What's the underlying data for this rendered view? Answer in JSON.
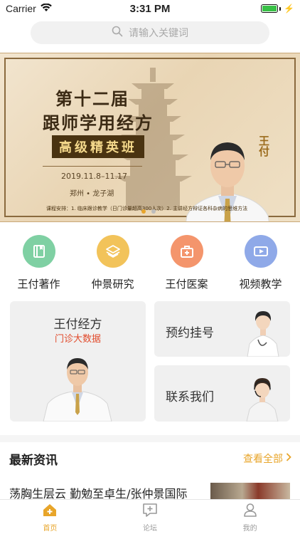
{
  "status_bar": {
    "carrier": "Carrier",
    "time": "3:31 PM",
    "battery_level": 1.0
  },
  "search": {
    "placeholder": "请输入关键词",
    "icon": "search-icon"
  },
  "banner": {
    "title_line1": "第十二届",
    "title_line2": "跟师学用经方",
    "class_badge": "高级精英班",
    "date": "2019.11.8–11.17",
    "location": "郑州 • 龙子湖",
    "teacher_name": "王付",
    "course_info": "课程安排：1. 临床跟诊教学（日门诊量超高300人次）2. 主讲经方辩证各科杂病的思维方法",
    "page_count": 2,
    "active_page": 1
  },
  "categories": [
    {
      "label": "王付著作",
      "icon": "book-icon",
      "color": "#7fd0a3"
    },
    {
      "label": "仲景研究",
      "icon": "layers-icon",
      "color": "#f2c35a"
    },
    {
      "label": "王付医案",
      "icon": "medical-kit-icon",
      "color": "#f4956c"
    },
    {
      "label": "视频教学",
      "icon": "video-icon",
      "color": "#8fa9e8"
    }
  ],
  "cards": {
    "big": {
      "title": "王付经方",
      "subtitle": "门诊大数据"
    },
    "appointment": {
      "title": "预约挂号"
    },
    "contact": {
      "title": "联系我们"
    }
  },
  "news": {
    "title": "最新资讯",
    "more": "查看全部",
    "items": [
      {
        "title": "荡胸生层云  勤勉至卓生/张仲景国际"
      }
    ]
  },
  "tabbar": {
    "tabs": [
      {
        "label": "首页",
        "icon": "home-icon",
        "active": true
      },
      {
        "label": "论坛",
        "icon": "forum-icon",
        "active": false
      },
      {
        "label": "我的",
        "icon": "user-icon",
        "active": false
      }
    ]
  },
  "colors": {
    "accent": "#e8a52a",
    "subtitle_red": "#e14a2b"
  }
}
